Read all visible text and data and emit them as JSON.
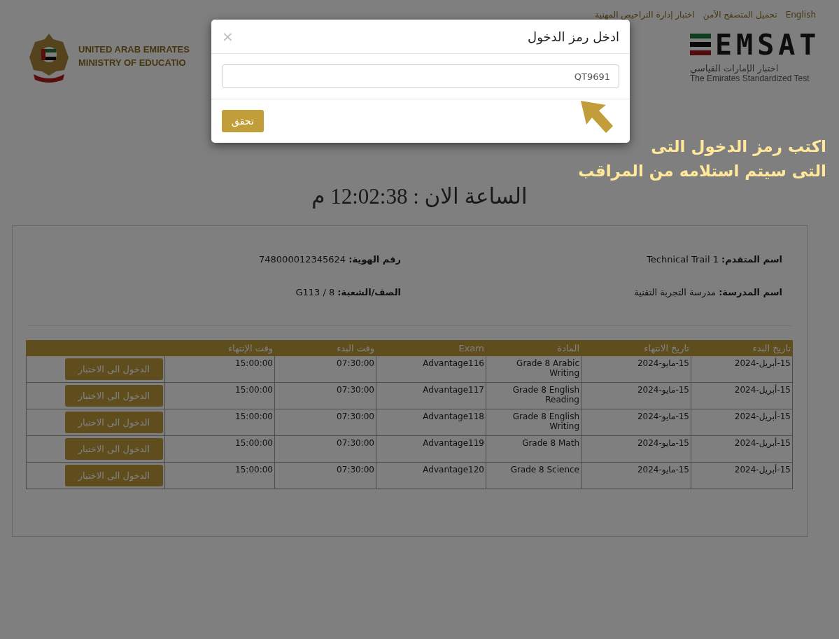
{
  "top_links": [
    {
      "label": "English"
    },
    {
      "label": "تحميل المتصفح الآمن"
    },
    {
      "label": "اختبار إدارة التراخيص المهنية"
    }
  ],
  "brand": {
    "logo": "EMSAT",
    "subtitle_ar": "اختبار الإمارات القياسي",
    "subtitle_en": "The Emirates Standardized Test"
  },
  "ministry": {
    "line_1": "UNITED ARAB EMIRATES",
    "line_2": "MINISTRY OF EDUCATIO"
  },
  "clock": "الساعة الان : 12:02:38 م",
  "info": [
    {
      "label": "اسم المتقدم:",
      "value": "Technical Trail 1"
    },
    {
      "label": "رقم الهوية:",
      "value": "748000012345624"
    },
    {
      "label": "اسم المدرسة:",
      "value": "مدرسة التجربة التقنية"
    },
    {
      "label": "الصف/الشعبة:",
      "value": "G113 / 8"
    }
  ],
  "table": {
    "columns": [
      "تاريخ البدء",
      "تاريخ الانتهاء",
      "المادة",
      "Exam",
      "وقت البدء",
      "وقت الإنتهاء"
    ],
    "rows": [
      {
        "cells": [
          "15-أبريل-2024",
          "15-مايو-2024",
          "Grade 8 Arabic Writing",
          "Advantage116",
          "07:30:00",
          "15:00:00"
        ],
        "action": "الدخول الى الاختبار"
      },
      {
        "cells": [
          "15-أبريل-2024",
          "15-مايو-2024",
          "Grade 8 English Reading",
          "Advantage117",
          "07:30:00",
          "15:00:00"
        ],
        "action": "الدخول الى الاختبار"
      },
      {
        "cells": [
          "15-أبريل-2024",
          "15-مايو-2024",
          "Grade 8 English Writing",
          "Advantage118",
          "07:30:00",
          "15:00:00"
        ],
        "action": "الدخول الى الاختبار"
      },
      {
        "cells": [
          "15-أبريل-2024",
          "15-مايو-2024",
          "Grade 8 Math",
          "Advantage119",
          "07:30:00",
          "15:00:00"
        ],
        "action": "الدخول الى الاختبار"
      },
      {
        "cells": [
          "15-أبريل-2024",
          "15-مايو-2024",
          "Grade 8 Science",
          "Advantage120",
          "07:30:00",
          "15:00:00"
        ],
        "action": "الدخول الى الاختبار"
      }
    ]
  },
  "modal": {
    "title": "ادخل رمز الدخول",
    "close": "×",
    "code_value": "QT9691",
    "submit": "تحقق"
  },
  "annotation": {
    "lines": [
      "اكتب رمز الدخول التى",
      "التى سيتم استلامه من المراقب"
    ]
  }
}
